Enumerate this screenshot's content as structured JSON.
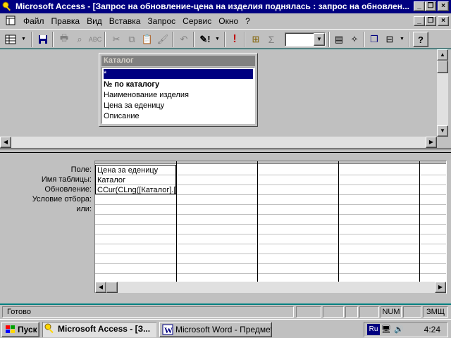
{
  "window": {
    "title": "Microsoft Access - [Запрос на обновление-цена на изделия поднялась : запрос на обновлен..."
  },
  "menu": {
    "items": [
      "Файл",
      "Правка",
      "Вид",
      "Вставка",
      "Запрос",
      "Сервис",
      "Окно",
      "?"
    ]
  },
  "toolbar": {
    "combo_value": ""
  },
  "table_window": {
    "title": "Каталог",
    "fields": [
      "*",
      "№ по каталогу",
      "Наименование изделия",
      "Цена за еденицу",
      "Описание"
    ]
  },
  "grid": {
    "row_labels": [
      "Поле:",
      "Имя таблицы:",
      "Обновление:",
      "Условие отбора:",
      "или:"
    ],
    "columns": [
      {
        "field": "Цена за еденицу",
        "table": "Каталог",
        "update": "CCur(CLng([Каталог].[Ц",
        "criteria": "",
        "or": ""
      },
      {
        "field": "",
        "table": "",
        "update": "",
        "criteria": "",
        "or": ""
      },
      {
        "field": "",
        "table": "",
        "update": "",
        "criteria": "",
        "or": ""
      },
      {
        "field": "",
        "table": "",
        "update": "",
        "criteria": "",
        "or": ""
      },
      {
        "field": "",
        "table": "",
        "update": "",
        "criteria": "",
        "or": ""
      }
    ]
  },
  "status": {
    "text": "Готово",
    "num": "NUM",
    "caps": "ЗМЩ"
  },
  "taskbar": {
    "start": "Пуск",
    "tasks": [
      "Microsoft Access - [З...",
      "Microsoft Word - Предмет..."
    ],
    "lang": "Ru",
    "clock": "4:24"
  },
  "colors": {
    "titlebar": "#000080",
    "face": "#c0c0c0",
    "selection": "#000080"
  }
}
